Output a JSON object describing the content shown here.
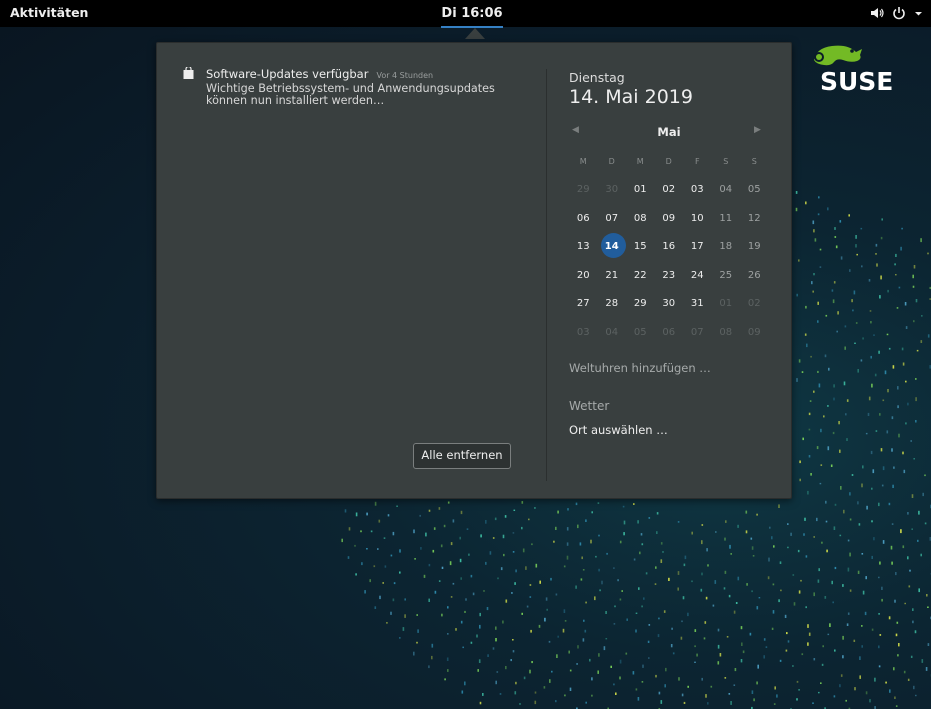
{
  "topbar": {
    "activities": "Aktivitäten",
    "clock": "Di 16:06",
    "icons": [
      "volume-icon",
      "power-icon",
      "chevron-down-icon"
    ]
  },
  "notification": {
    "icon": "shopping-bag-icon",
    "title": "Software-Updates verfügbar",
    "time": "Vor 4 Stunden",
    "body": "Wichtige Betriebssystem- und Anwendungsupdates können nun installiert werden…"
  },
  "clear_button": "Alle entfernen",
  "calendar": {
    "weekday": "Dienstag",
    "date": "14. Mai 2019",
    "month": "Mai",
    "prev_icon": "chevron-left-icon",
    "next_icon": "chevron-right-icon",
    "day_headers": [
      "M",
      "D",
      "M",
      "D",
      "F",
      "S",
      "S"
    ],
    "weeks": [
      [
        "29",
        "30",
        "01",
        "02",
        "03",
        "04",
        "05"
      ],
      [
        "06",
        "07",
        "08",
        "09",
        "10",
        "11",
        "12"
      ],
      [
        "13",
        "14",
        "15",
        "16",
        "17",
        "18",
        "19"
      ],
      [
        "20",
        "21",
        "22",
        "23",
        "24",
        "25",
        "26"
      ],
      [
        "27",
        "28",
        "29",
        "30",
        "31",
        "01",
        "02"
      ],
      [
        "03",
        "04",
        "05",
        "06",
        "07",
        "08",
        "09"
      ]
    ],
    "today": "14"
  },
  "world_clocks": "Weltuhren hinzufügen …",
  "weather": {
    "title": "Wetter",
    "location": "Ort auswählen …"
  },
  "logo": {
    "text": "SUSE",
    "color": "#73ba25"
  },
  "colors": {
    "accent": "#215d9c",
    "panel": "#393f3f"
  }
}
